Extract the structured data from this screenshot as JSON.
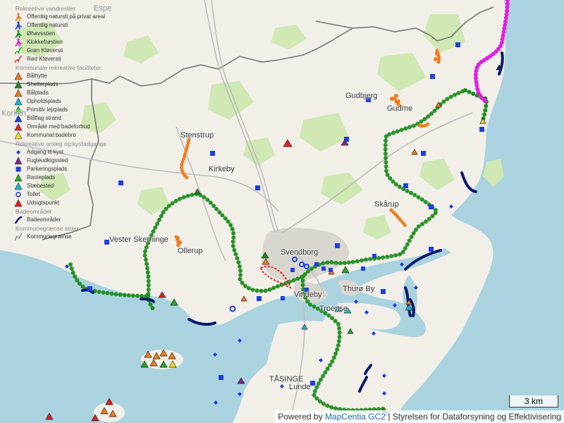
{
  "legend": {
    "groups": [
      {
        "title": "Rekreative vandrestier",
        "items": [
          {
            "label": "Offentlig natursti på privat areal",
            "icon": "orange-hiker-icon",
            "color": "#f07c1b"
          },
          {
            "label": "Offentlig natursti",
            "icon": "blue-hiker-icon",
            "color": "#1c3fd6"
          },
          {
            "label": "Øhavsstien",
            "icon": "green-hiker-icon",
            "color": "#1d8c1d"
          },
          {
            "label": "Klokkefrøstien",
            "icon": "magenta-hiker-icon",
            "color": "#e21ee2"
          },
          {
            "label": "Grøn Kløversti",
            "icon": "green-path-icon",
            "color": "#22aa22"
          },
          {
            "label": "Rød Kløversti",
            "icon": "red-path-icon",
            "color": "#e02020"
          }
        ]
      },
      {
        "title": "Kommunale rekreative faciliteter",
        "items": [
          {
            "label": "Bålhytte",
            "icon": "orange-hut-triangle-icon",
            "color": "#f07c1b"
          },
          {
            "label": "Shelterplads",
            "icon": "green-shelter-triangle-icon",
            "color": "#1d8c1d"
          },
          {
            "label": "Bålplads",
            "icon": "orange-fire-triangle-icon",
            "color": "#f07c1b"
          },
          {
            "label": "Opholdsplads",
            "icon": "cyan-stay-triangle-icon",
            "color": "#17b5d4"
          },
          {
            "label": "Primitiv lejrplads",
            "icon": "lime-camp-triangle-icon",
            "color": "#27d627"
          },
          {
            "label": "Blåflag strand",
            "icon": "blue-flag-triangle-icon",
            "color": "#1d3fe0"
          },
          {
            "label": "Område med badeforbud",
            "icon": "red-nobath-triangle-icon",
            "color": "#e02020"
          },
          {
            "label": "Kommunal badebro",
            "icon": "yellow-bridge-triangle-icon",
            "color": "#f0e020"
          }
        ]
      },
      {
        "title": "Rekreative anlæg og kystadgange",
        "items": [
          {
            "label": "Adgang til kyst",
            "icon": "blue-diamond-icon",
            "color": "#1d3fe0"
          },
          {
            "label": "Fugleudkigssted",
            "icon": "purple-bird-triangle-icon",
            "color": "#7a2a8a"
          },
          {
            "label": "Parkeringsplads",
            "icon": "blue-square-icon",
            "color": "#1d3fe0"
          },
          {
            "label": "Rasteplads",
            "icon": "green-rest-triangle-icon",
            "color": "#22aa22"
          },
          {
            "label": "Slæbested",
            "icon": "cyan-slip-triangle-icon",
            "color": "#17b5d4"
          },
          {
            "label": "Toilet",
            "icon": "blue-ring-icon",
            "color": "#1d3fe0"
          },
          {
            "label": "Udsigtspunkt",
            "icon": "red-view-triangle-icon",
            "color": "#e02020"
          }
        ]
      },
      {
        "title": "Badeområder",
        "items": [
          {
            "label": "Badeområder",
            "icon": "navy-beach-line-icon",
            "color": "#0a1a6e"
          }
        ]
      },
      {
        "title": "Kommunegrænse streg",
        "items": [
          {
            "label": "Kommunegrænse",
            "icon": "grey-boundary-line-icon",
            "color": "#777777"
          }
        ]
      }
    ]
  },
  "places": [
    {
      "name": "Espe",
      "faint": true
    },
    {
      "name": "Korinth",
      "faint": true
    },
    {
      "name": "Gudbjerg",
      "faint": false
    },
    {
      "name": "Gudme",
      "faint": false
    },
    {
      "name": "Stenstrup",
      "faint": false
    },
    {
      "name": "Kirkeby",
      "faint": false
    },
    {
      "name": "Skårup",
      "faint": false
    },
    {
      "name": "Vester Skerninge",
      "faint": false
    },
    {
      "name": "Ollerup",
      "faint": false
    },
    {
      "name": "Svendborg",
      "faint": false
    },
    {
      "name": "Thurø By",
      "faint": false
    },
    {
      "name": "Troense",
      "faint": false
    },
    {
      "name": "Vindeby",
      "faint": false
    },
    {
      "name": "TÅSINGE",
      "faint": false
    },
    {
      "name": "Lunde",
      "faint": false
    }
  ],
  "scale": {
    "label": "3 km"
  },
  "credits": {
    "prefix": "Powered by ",
    "link": "MapCentia GC2",
    "suffix": " | Styrelsen for Dataforsyning og Effektivisering"
  },
  "colors": {
    "land": "#f2efe9",
    "water": "#aad3df",
    "forest": "#c8e6a8",
    "urban": "#d9d6d0",
    "road": "#aaaaaa",
    "boundary": "#777777"
  }
}
